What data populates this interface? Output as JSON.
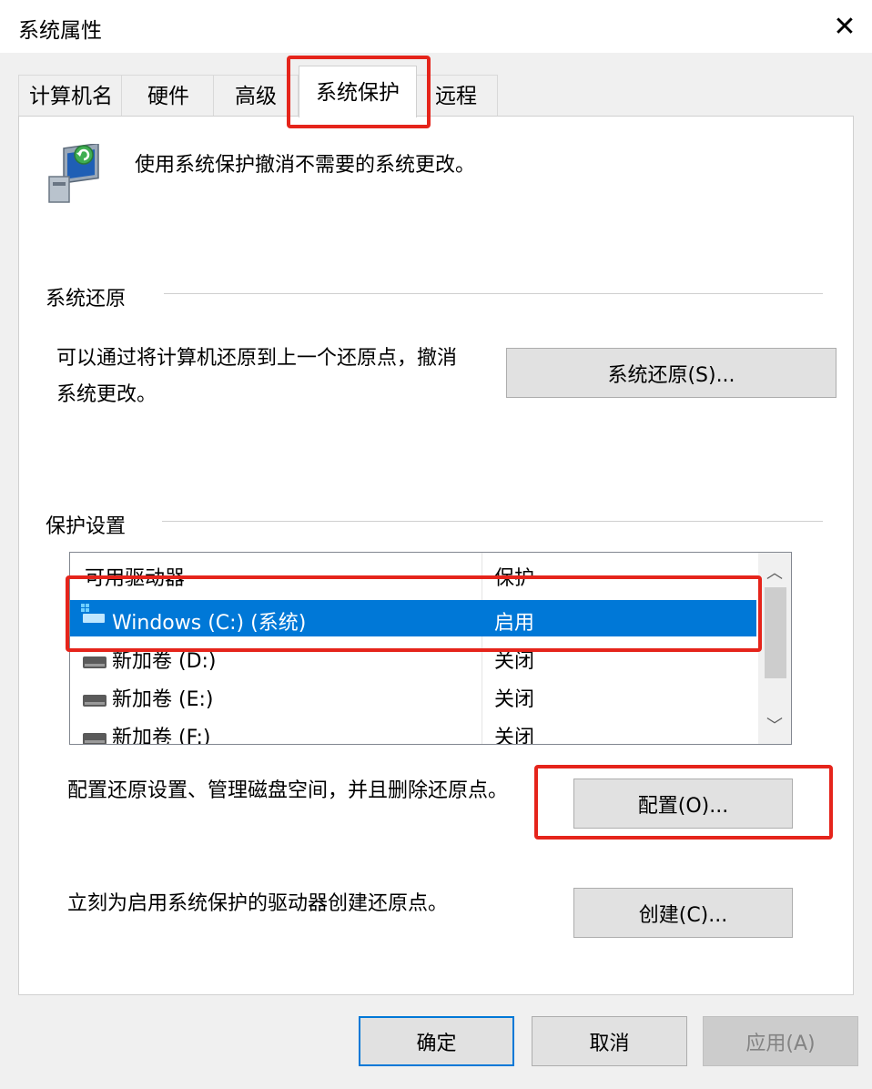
{
  "window": {
    "title": "系统属性",
    "close_label": "✕"
  },
  "tabs": [
    {
      "label": "计算机名",
      "active": false
    },
    {
      "label": "硬件",
      "active": false
    },
    {
      "label": "高级",
      "active": false
    },
    {
      "label": "系统保护",
      "active": true
    },
    {
      "label": "远程",
      "active": false
    }
  ],
  "intro": {
    "icon": "system-protection-icon",
    "text": "使用系统保护撤消不需要的系统更改。"
  },
  "system_restore": {
    "heading": "系统还原",
    "description_line1": "可以通过将计算机还原到上一个还原点，撤消",
    "description_line2": "系统更改。",
    "button_label": "系统还原(S)..."
  },
  "protection_settings": {
    "heading": "保护设置",
    "columns": {
      "drive": "可用驱动器",
      "status": "保护"
    },
    "drives": [
      {
        "name": "Windows (C:) (系统)",
        "status": "启用",
        "selected": true,
        "icon": "system-drive-icon"
      },
      {
        "name": "新加卷 (D:)",
        "status": "关闭",
        "selected": false,
        "icon": "drive-icon"
      },
      {
        "name": "新加卷 (E:)",
        "status": "关闭",
        "selected": false,
        "icon": "drive-icon"
      },
      {
        "name": "新加卷 (F:)",
        "status": "关闭",
        "selected": false,
        "icon": "drive-icon"
      }
    ],
    "configure_text": "配置还原设置、管理磁盘空间，并且删除还原点。",
    "configure_button": "配置(O)...",
    "create_text": "立刻为启用系统保护的驱动器创建还原点。",
    "create_button": "创建(C)..."
  },
  "footer": {
    "ok": "确定",
    "cancel": "取消",
    "apply": "应用(A)"
  },
  "colors": {
    "highlight_red": "#e5241b",
    "selection_blue": "#0078d7"
  }
}
